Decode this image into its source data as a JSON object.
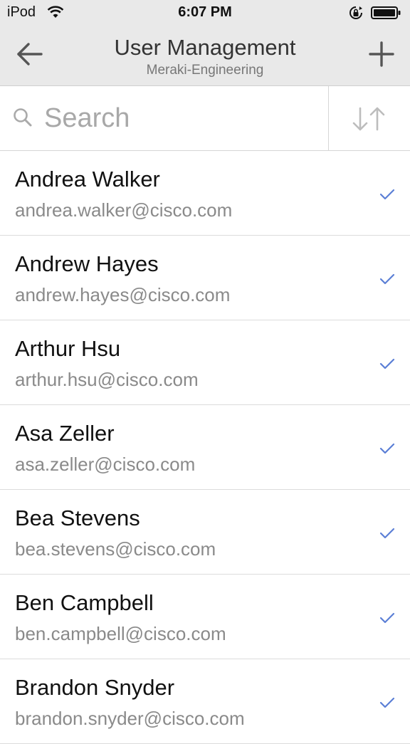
{
  "status_bar": {
    "carrier": "iPod",
    "time": "6:07 PM"
  },
  "header": {
    "title": "User Management",
    "subtitle": "Meraki-Engineering",
    "back_icon": "arrow-left-icon",
    "add_icon": "plus-icon"
  },
  "search": {
    "placeholder": "Search",
    "value": "",
    "sort_icon": "sort-down-up-icon"
  },
  "users": [
    {
      "name": "Andrea Walker",
      "email": "andrea.walker@cisco.com",
      "checked": true
    },
    {
      "name": "Andrew Hayes",
      "email": "andrew.hayes@cisco.com",
      "checked": true
    },
    {
      "name": "Arthur Hsu",
      "email": "arthur.hsu@cisco.com",
      "checked": true
    },
    {
      "name": "Asa Zeller",
      "email": "asa.zeller@cisco.com",
      "checked": true
    },
    {
      "name": "Bea Stevens",
      "email": "bea.stevens@cisco.com",
      "checked": true
    },
    {
      "name": "Ben Campbell",
      "email": "ben.campbell@cisco.com",
      "checked": true
    },
    {
      "name": "Brandon Snyder",
      "email": "brandon.snyder@cisco.com",
      "checked": true
    }
  ],
  "colors": {
    "header_bg": "#e9e9e9",
    "check": "#5b7fd6",
    "secondary_text": "#8a8a8a"
  }
}
